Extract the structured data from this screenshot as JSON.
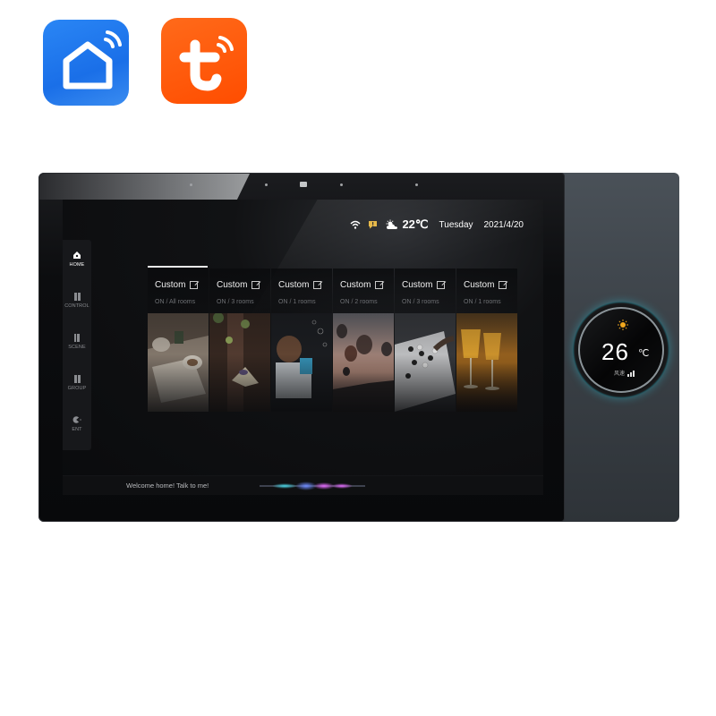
{
  "app_icons": [
    {
      "name": "Smart Life",
      "icon": "house-wifi-icon",
      "color": "#1a6fe8"
    },
    {
      "name": "Tuya",
      "icon": "t-wifi-icon",
      "color": "#ff4d00"
    }
  ],
  "status_bar": {
    "wifi_icon": "wifi-icon",
    "alert_icon": "message-alert-icon",
    "weather_icon": "sun-cloud-icon",
    "temperature": "22℃",
    "day": "Tuesday",
    "date": "2021/4/20"
  },
  "sidebar": {
    "items": [
      {
        "label": "HOME",
        "icon": "home-icon",
        "active": true
      },
      {
        "label": "CONTROL",
        "icon": "control-icon",
        "active": false
      },
      {
        "label": "SCENE",
        "icon": "scene-icon",
        "active": false
      },
      {
        "label": "GROUP",
        "icon": "group-icon",
        "active": false
      },
      {
        "label": "ENT",
        "icon": "entertainment-icon",
        "active": false
      }
    ]
  },
  "scenes": [
    {
      "title": "Custom",
      "subtitle": "ON / All rooms",
      "photo": "coffee-table"
    },
    {
      "title": "Custom",
      "subtitle": "ON / 3 rooms",
      "photo": "hummingbird"
    },
    {
      "title": "Custom",
      "subtitle": "ON / 1 rooms",
      "photo": "child-bubbles"
    },
    {
      "title": "Custom",
      "subtitle": "ON / 2 rooms",
      "photo": "hot-air-balloons"
    },
    {
      "title": "Custom",
      "subtitle": "ON / 3 rooms",
      "photo": "go-board"
    },
    {
      "title": "Custom",
      "subtitle": "ON / 1 rooms",
      "photo": "champagne-glasses"
    }
  ],
  "voice": {
    "prompt": "Welcome home! Talk to me!"
  },
  "thermostat": {
    "temperature": "26",
    "unit": "℃",
    "mode_icon": "sun-icon",
    "fan_label": "风速",
    "accent": "#2fb3c4"
  }
}
